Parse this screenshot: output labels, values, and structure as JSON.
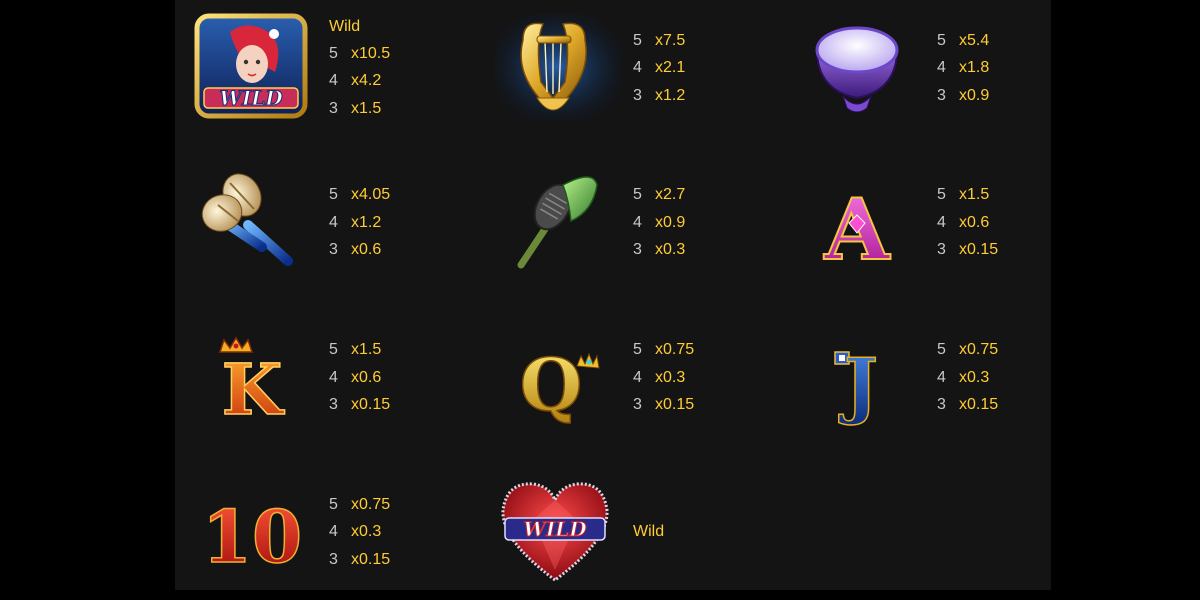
{
  "colors": {
    "background": "#141414",
    "count_text": "#c8c8c8",
    "multiplier_text": "#ffcc33"
  },
  "symbols": [
    {
      "icon": "mermaid-wild-icon",
      "badge": "WILD",
      "label": "Wild",
      "pays": [
        {
          "count": "5",
          "mult": "x10.5"
        },
        {
          "count": "4",
          "mult": "x4.2"
        },
        {
          "count": "3",
          "mult": "x1.5"
        }
      ]
    },
    {
      "icon": "lyre-icon",
      "pays": [
        {
          "count": "5",
          "mult": "x7.5"
        },
        {
          "count": "4",
          "mult": "x2.1"
        },
        {
          "count": "3",
          "mult": "x1.2"
        }
      ]
    },
    {
      "icon": "pearl-drum-icon",
      "pays": [
        {
          "count": "5",
          "mult": "x5.4"
        },
        {
          "count": "4",
          "mult": "x1.8"
        },
        {
          "count": "3",
          "mult": "x0.9"
        }
      ]
    },
    {
      "icon": "shell-maracas-icon",
      "pays": [
        {
          "count": "5",
          "mult": "x4.05"
        },
        {
          "count": "4",
          "mult": "x1.2"
        },
        {
          "count": "3",
          "mult": "x0.6"
        }
      ]
    },
    {
      "icon": "shell-microphone-icon",
      "pays": [
        {
          "count": "5",
          "mult": "x2.7"
        },
        {
          "count": "4",
          "mult": "x0.9"
        },
        {
          "count": "3",
          "mult": "x0.3"
        }
      ]
    },
    {
      "icon": "letter-a-icon",
      "glyph": "A",
      "pays": [
        {
          "count": "5",
          "mult": "x1.5"
        },
        {
          "count": "4",
          "mult": "x0.6"
        },
        {
          "count": "3",
          "mult": "x0.15"
        }
      ]
    },
    {
      "icon": "letter-k-icon",
      "glyph": "K",
      "pays": [
        {
          "count": "5",
          "mult": "x1.5"
        },
        {
          "count": "4",
          "mult": "x0.6"
        },
        {
          "count": "3",
          "mult": "x0.15"
        }
      ]
    },
    {
      "icon": "letter-q-icon",
      "glyph": "Q",
      "pays": [
        {
          "count": "5",
          "mult": "x0.75"
        },
        {
          "count": "4",
          "mult": "x0.3"
        },
        {
          "count": "3",
          "mult": "x0.15"
        }
      ]
    },
    {
      "icon": "letter-j-icon",
      "glyph": "J",
      "pays": [
        {
          "count": "5",
          "mult": "x0.75"
        },
        {
          "count": "4",
          "mult": "x0.3"
        },
        {
          "count": "3",
          "mult": "x0.15"
        }
      ]
    },
    {
      "icon": "number-10-icon",
      "glyph": "10",
      "pays": [
        {
          "count": "5",
          "mult": "x0.75"
        },
        {
          "count": "4",
          "mult": "x0.3"
        },
        {
          "count": "3",
          "mult": "x0.15"
        }
      ]
    },
    {
      "icon": "heart-wild-icon",
      "badge": "WILD",
      "label": "Wild"
    }
  ]
}
